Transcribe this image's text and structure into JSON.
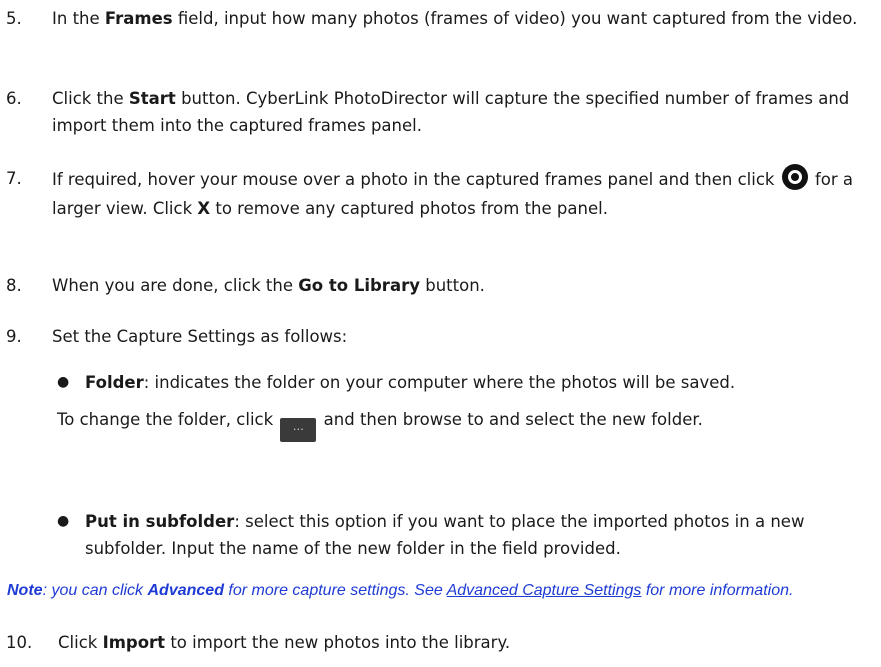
{
  "steps": {
    "s5": {
      "num": "5.",
      "t1": "In the ",
      "b1": "Frames",
      "t2": " field, input how many photos (frames of video) you want captured from the video."
    },
    "s6": {
      "num": "6.",
      "t1": "Click the ",
      "b1": "Start",
      "t2": " button. CyberLink PhotoDirector will capture the specified number of frames and import them into the captured frames panel."
    },
    "s7": {
      "num": "7.",
      "t1": "If required, hover your mouse over a photo in the captured frames panel and then click ",
      "t2": " for a larger view. Click ",
      "b1": "X",
      "t3": " to remove any captured photos from the panel."
    },
    "s8": {
      "num": "8.",
      "t1": "When you are done, click the ",
      "b1": "Go to Library",
      "t2": " button."
    },
    "s9": {
      "num": "9.",
      "t1": "Set the Capture Settings as follows:"
    },
    "s10": {
      "num": "10.",
      "t1": "Click ",
      "b1": "Import",
      "t2": " to import the new photos into the library."
    }
  },
  "bullets": {
    "folder": {
      "b1": "Folder",
      "t1": ": indicates the folder on your computer where the photos will be saved.",
      "t2": "To change the folder, click ",
      "t3": " and then browse to and select the new folder."
    },
    "subfolder": {
      "b1": "Put in subfolder",
      "t1": ": select this option if you want to place the imported photos in a new subfolder. Input the name of the new folder in the field provided."
    }
  },
  "note": {
    "label": "Note",
    "t1": ": you can click ",
    "b1": "Advanced",
    "t2": " for more capture settings. See ",
    "link": "Advanced Capture Settings",
    "t3": " for more information."
  },
  "icons": {
    "view": "larger-view-icon",
    "browse": "browse-folder-icon",
    "browse_glyph": "…"
  },
  "colors": {
    "note": "#1f3bd6",
    "text": "#1a1a1a"
  }
}
